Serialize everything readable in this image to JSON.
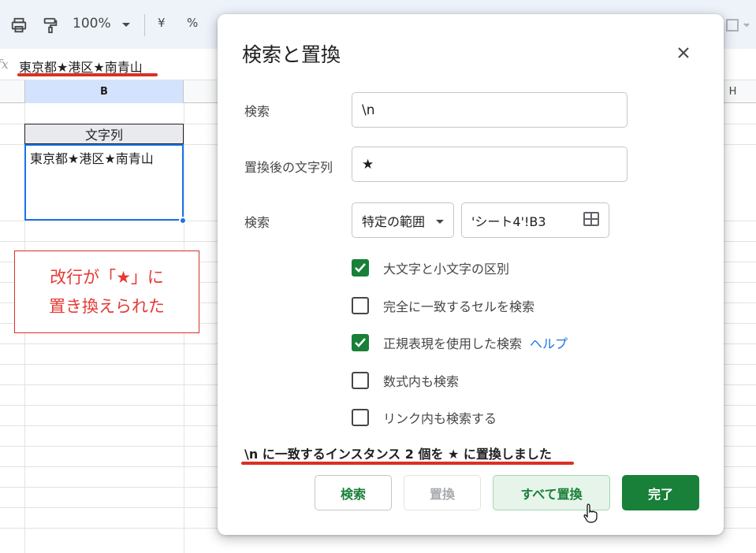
{
  "toolbar": {
    "zoom": "100%",
    "currency": "¥",
    "percent": "%"
  },
  "formula_bar": {
    "fx": "fx",
    "content": "東京都★港区★南青山"
  },
  "sheet": {
    "col_b": "B",
    "col_h": "H",
    "header_cell": "文字列",
    "selected_cell": "東京都★港区★南青山",
    "note_line1": "改行が「★」に",
    "note_line2": "置き換えられた"
  },
  "dialog": {
    "title": "検索と置換",
    "find_label": "検索",
    "find_value": "\\n",
    "replace_label": "置換後の文字列",
    "replace_value": "★",
    "scope_label": "検索",
    "scope_value": "特定の範囲",
    "range_value": "'シート4'!B3",
    "options": [
      {
        "label": "大文字と小文字の区別",
        "checked": true
      },
      {
        "label": "完全に一致するセルを検索",
        "checked": false
      },
      {
        "label": "正規表現を使用した検索",
        "checked": true
      },
      {
        "label": "数式内も検索",
        "checked": false
      },
      {
        "label": "リンク内も検索する",
        "checked": false
      }
    ],
    "help_link": "ヘルプ",
    "result_message": "\\n に一致するインスタンス 2 個を ★ に置換しました",
    "buttons": {
      "search": "検索",
      "replace": "置換",
      "replace_all": "すべて置換",
      "done": "完了"
    }
  },
  "colors": {
    "accent_green": "#188038",
    "selection_blue": "#1a73e8",
    "annotation_red": "#d93025"
  }
}
